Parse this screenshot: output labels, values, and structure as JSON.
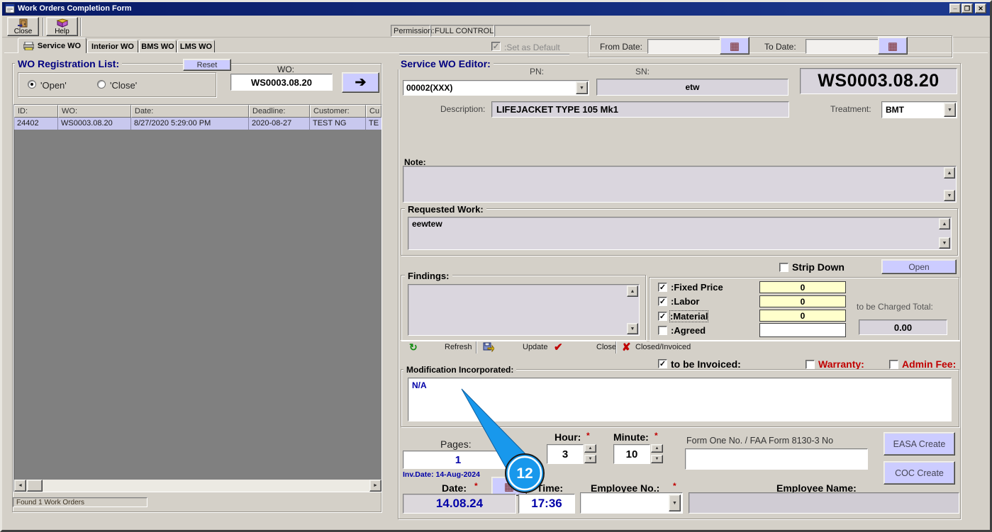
{
  "window": {
    "title": "Work Orders Completion Form"
  },
  "icons": {
    "minimize": "_",
    "restore": "❐",
    "close": "✕",
    "arrow_right": "➔",
    "calendar": "▦",
    "combo_arrow": "▼",
    "spin_up": "▲",
    "spin_down": "▼",
    "scroll_up": "▲",
    "scroll_down": "▼",
    "scroll_left": "◄",
    "scroll_right": "►",
    "refresh": "↻",
    "red_check": "✔",
    "red_cross": "✘",
    "checkmark": "✓"
  },
  "toolbar": {
    "close_label": "Close",
    "help_label": "Help",
    "permission_label": "Permission:",
    "permission_value": "FULL CONTROL"
  },
  "tabs": [
    {
      "label": "Service WO"
    },
    {
      "label": "Interior WO"
    },
    {
      "label": "BMS WO"
    },
    {
      "label": "LMS WO"
    }
  ],
  "filters": {
    "set_default_label": ":Set as Default",
    "from_date_label": "From Date:",
    "from_date_value": "",
    "to_date_label": "To Date:",
    "to_date_value": ""
  },
  "wo_list": {
    "title": "WO Registration List:",
    "reset_label": "Reset",
    "open_label": "'Open'",
    "close_label": "'Close'",
    "wo_label": "WO:",
    "wo_value": "WS0003.08.20",
    "columns": [
      "ID:",
      "WO:",
      "Date:",
      "Deadline:",
      "Customer:",
      "Cu"
    ],
    "rows": [
      [
        "24402",
        "WS0003.08.20",
        "8/27/2020 5:29:00 PM",
        "2020-08-27",
        "TEST NG",
        "TE"
      ]
    ],
    "status": "Found 1 Work Orders"
  },
  "editor": {
    "title": "Service WO Editor:",
    "pn_label": "PN:",
    "pn_value": "00002(XXX)",
    "sn_label": "SN:",
    "sn_value": "etw",
    "wo_number": "WS0003.08.20",
    "description_label": "Description:",
    "description_value": "LIFEJACKET TYPE 105 Mk1",
    "treatment_label": "Treatment:",
    "treatment_value": "BMT",
    "note_label": "Note:",
    "note_value": "",
    "requested_work_label": "Requested Work:",
    "requested_work_value": "eewtew",
    "strip_down_label": "Strip Down",
    "open_button": "Open",
    "findings_label": "Findings:",
    "findings_value": "",
    "charges": {
      "fixed_price_label": ":Fixed Price",
      "fixed_price_value": "0",
      "labor_label": ":Labor",
      "labor_value": "0",
      "material_label": ":Material",
      "material_value": "0",
      "agreed_label": ":Agreed",
      "agreed_value": "",
      "total_label": "to be Charged Total:",
      "total_value": "0.00"
    },
    "actions": {
      "refresh": "Refresh",
      "update": "Update",
      "close": "Close",
      "closed_invoiced": "Closed/Invoiced"
    },
    "flags": {
      "to_be_invoiced": "to be Invoiced:",
      "warranty": "Warranty:",
      "admin_fee": "Admin Fee:"
    },
    "modification_label": "Modification Incorporated:",
    "modification_value": "N/A",
    "pages_label": "Pages:",
    "pages_value": "1",
    "inv_date": "Inv.Date: 14-Aug-2024",
    "hour_label": "Hour:",
    "hour_value": "3",
    "minute_label": "Minute:",
    "minute_value": "10",
    "required_mark": "*",
    "form_one_label": "Form One No. / FAA Form 8130-3 No",
    "form_one_value": "",
    "easa_button": "EASA Create",
    "coc_button": "COC Create",
    "date_label": "Date:",
    "date_value": "14.08.24",
    "time_label": "Time:",
    "time_value": "17:36",
    "employee_no_label": "Employee No.:",
    "employee_no_value": "",
    "employee_name_label": "Employee Name:",
    "employee_name_value": ""
  },
  "cursor": {
    "badge": "12"
  },
  "colors": {
    "titlebar": "#081a66",
    "accent_lavender": "#ccccff",
    "field_yellow": "#ffffcc",
    "row_highlight": "#c8c8ee",
    "text_navy": "#000080",
    "text_blue": "#0000a8",
    "text_red": "#cc0000",
    "cursor_blue": "#1898ec"
  }
}
